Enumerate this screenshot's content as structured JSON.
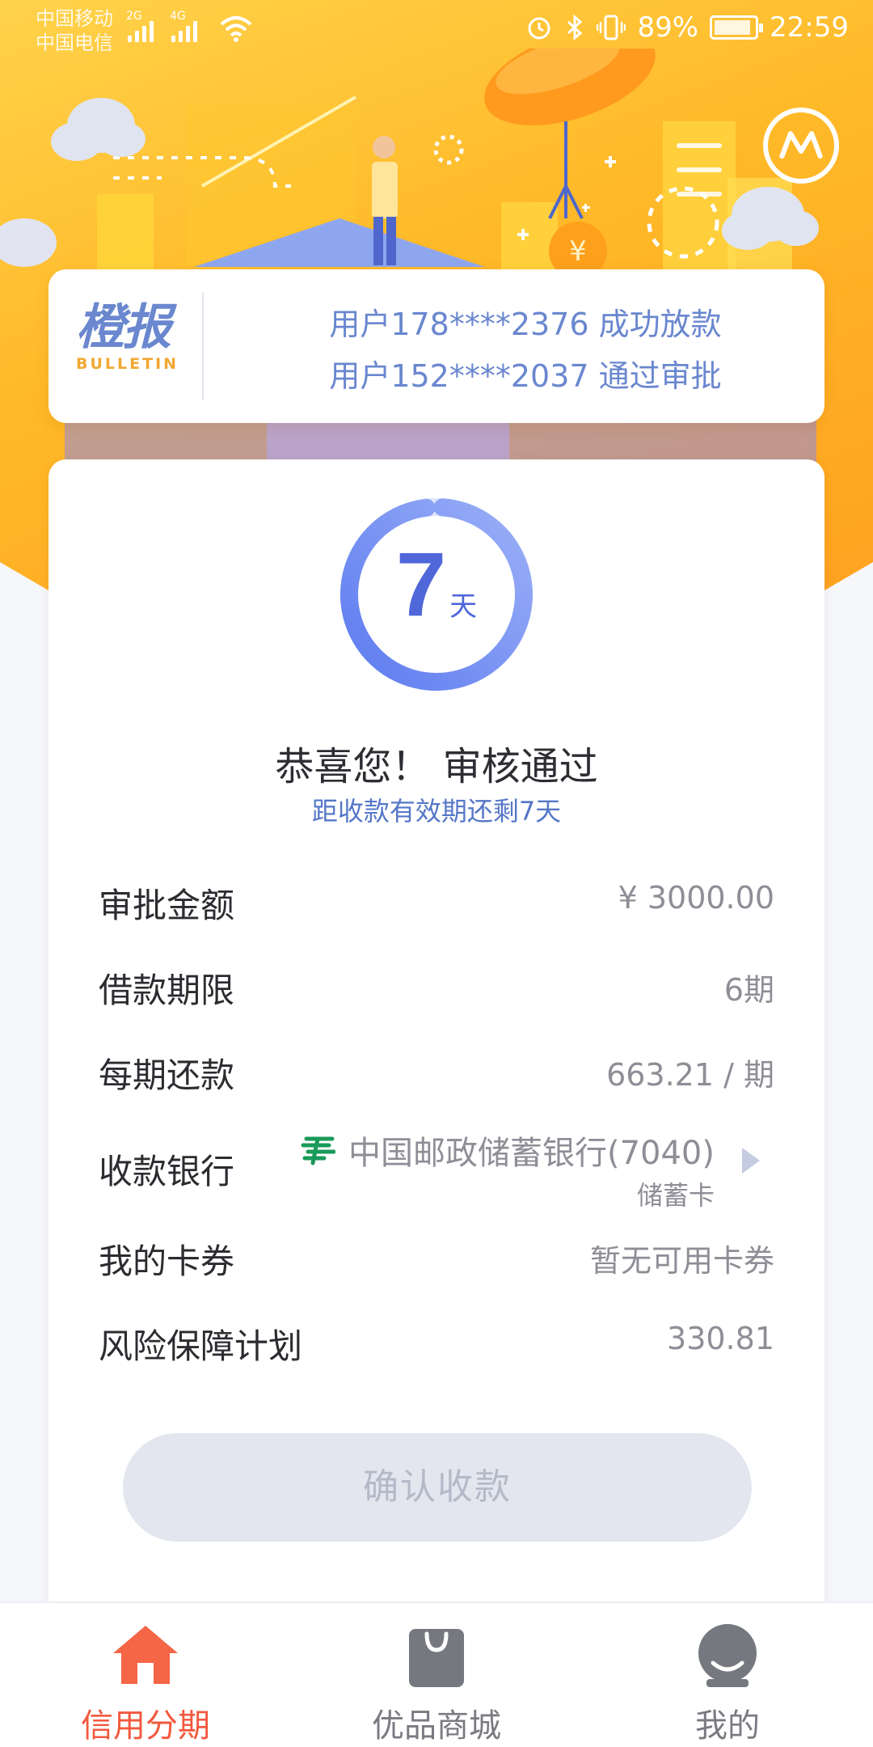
{
  "status_bar": {
    "carrier1": "中国移动",
    "carrier2": "中国电信",
    "net1": "2G",
    "net2": "4G",
    "battery_percent": "89%",
    "time": "22:59"
  },
  "bulletin": {
    "logo_cn": "橙报",
    "logo_en": "BULLETIN",
    "lines": [
      "用户178****2376 成功放款",
      "用户152****2037 通过审批"
    ]
  },
  "countdown": {
    "number": "7",
    "unit": "天",
    "progress": 0.97
  },
  "result": {
    "title": "恭喜您！ 审核通过",
    "subtitle": "距收款有效期还剩7天"
  },
  "details": {
    "amount": {
      "label": "审批金额",
      "value": "¥ 3000.00"
    },
    "term": {
      "label": "借款期限",
      "value": "6期"
    },
    "installment": {
      "label": "每期还款",
      "value": "663.21 / 期"
    },
    "bank": {
      "label": "收款银行",
      "name": "中国邮政储蓄银行(7040)",
      "type": "储蓄卡"
    },
    "coupon": {
      "label": "我的卡券",
      "value": "暂无可用卡券"
    },
    "insurance": {
      "label": "风险保障计划",
      "value": "330.81"
    }
  },
  "confirm_button": "确认收款",
  "tabs": [
    {
      "label": "信用分期",
      "icon": "home-icon",
      "active": true
    },
    {
      "label": "优品商城",
      "icon": "shopping-bag-icon",
      "active": false
    },
    {
      "label": "我的",
      "icon": "profile-icon",
      "active": false
    }
  ],
  "colors": {
    "accent_blue": "#5577c8",
    "accent_orange": "#f2593f",
    "hero_yellow": "#ffb928"
  }
}
